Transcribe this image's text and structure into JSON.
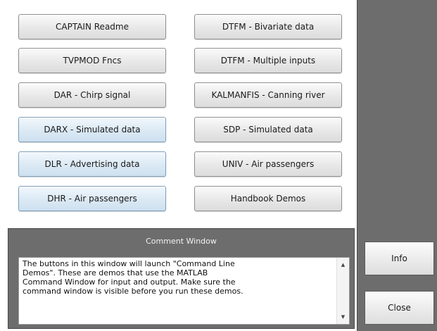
{
  "buttons": {
    "left": [
      {
        "label": "CAPTAIN Readme",
        "style": "grey"
      },
      {
        "label": "TVPMOD Fncs",
        "style": "grey"
      },
      {
        "label": "DAR - Chirp signal",
        "style": "grey"
      },
      {
        "label": "DARX - Simulated data",
        "style": "blue"
      },
      {
        "label": "DLR - Advertising data",
        "style": "blue"
      },
      {
        "label": "DHR - Air passengers",
        "style": "blue"
      }
    ],
    "right": [
      {
        "label": "DTFM - Bivariate data",
        "style": "grey"
      },
      {
        "label": "DTFM - Multiple inputs",
        "style": "grey"
      },
      {
        "label": "KALMANFIS - Canning river",
        "style": "grey"
      },
      {
        "label": "SDP - Simulated data",
        "style": "grey"
      },
      {
        "label": "UNIV - Air passengers",
        "style": "grey"
      },
      {
        "label": "Handbook Demos",
        "style": "grey"
      }
    ]
  },
  "side": {
    "info_label": "Info",
    "close_label": "Close"
  },
  "comment": {
    "title": "Comment Window",
    "lines": [
      "The buttons in this window will launch \"Command Line",
      "Demos\". These are demos that use the MATLAB",
      "Command Window for input and output. Make sure the",
      "command window is visible before you run these demos."
    ]
  },
  "icons": {
    "scroll_up": "scroll-up-arrow-icon",
    "scroll_down": "scroll-down-arrow-icon"
  },
  "colors": {
    "panel_bg": "#6d6d6d",
    "button_blue": "#dbe9f4",
    "button_grey": "#e8e8e8"
  }
}
